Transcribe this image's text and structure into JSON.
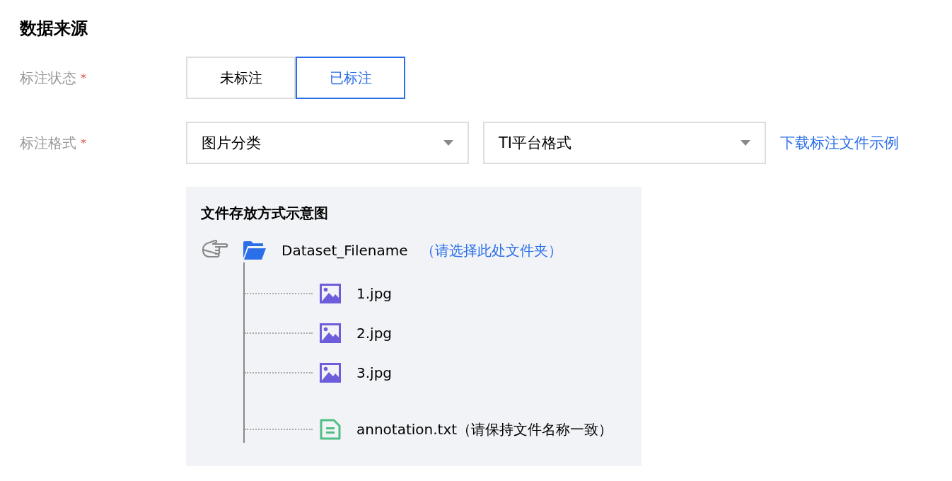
{
  "section_title": "数据来源",
  "fields": [
    {
      "label": "标注状态",
      "mark": "*",
      "kind": "segmented",
      "options": [
        {
          "label": "未标注",
          "selected": false
        },
        {
          "label": "已标注",
          "selected": true
        }
      ]
    },
    {
      "label": "标注格式",
      "mark": "*",
      "kind": "selects",
      "selects": [
        {
          "value": "图片分类"
        },
        {
          "value": "TI平台格式"
        }
      ],
      "link": "下载标注文件示例"
    }
  ],
  "diagram": {
    "title": "文件存放方式示意图",
    "root": {
      "name": "Dataset_Filename",
      "hint": "（请选择此处文件夹）"
    },
    "children": [
      {
        "kind": "image",
        "name": "1.jpg"
      },
      {
        "kind": "image",
        "name": "2.jpg"
      },
      {
        "kind": "image",
        "name": "3.jpg"
      },
      {
        "kind": "text",
        "name": "annotation.txt（请保持文件名称一致）"
      }
    ]
  }
}
